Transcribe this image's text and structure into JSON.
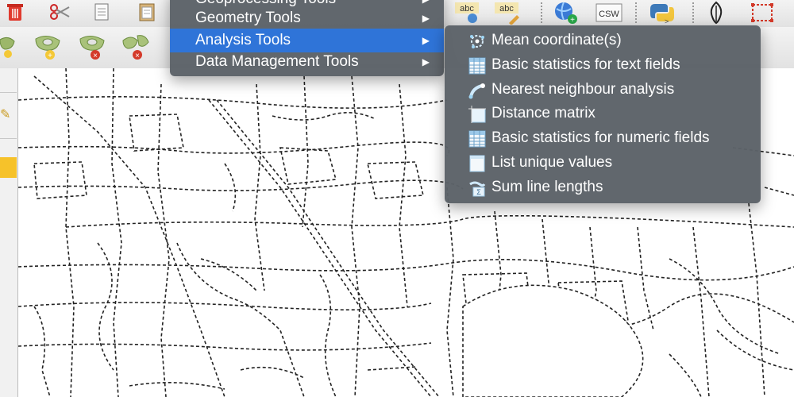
{
  "toolbar": {
    "top_icons": [
      {
        "name": "delete-icon"
      },
      {
        "name": "cut-icon"
      },
      {
        "name": "copy-features-icon"
      },
      {
        "name": "paste-features-icon"
      },
      {
        "name": "label-tool-icon",
        "text": "abc"
      },
      {
        "name": "label-edit-icon",
        "text": "abc"
      },
      {
        "name": "metasearch-icon"
      },
      {
        "name": "csw-icon",
        "text": "CSW"
      },
      {
        "name": "python-console-icon"
      },
      {
        "name": "georeferencer-icon"
      },
      {
        "name": "select-rectangle-icon"
      }
    ],
    "digitize_icons": [
      {
        "name": "add-feature-icon"
      },
      {
        "name": "add-ring-icon"
      },
      {
        "name": "delete-ring-icon"
      },
      {
        "name": "delete-part-icon"
      }
    ]
  },
  "main_menu": {
    "items": [
      {
        "label": "Geoprocessing Tools",
        "has_submenu": true
      },
      {
        "label": "Geometry Tools",
        "has_submenu": true
      },
      {
        "label": "Analysis Tools",
        "has_submenu": true,
        "active": true
      },
      {
        "label": "Data Management Tools",
        "has_submenu": true
      }
    ]
  },
  "submenu": {
    "items": [
      {
        "label": "Mean coordinate(s)",
        "icon": "mean-coordinates-icon"
      },
      {
        "label": "Basic statistics for text fields",
        "icon": "statistics-table-icon"
      },
      {
        "label": "Nearest neighbour analysis",
        "icon": "nearest-neighbour-icon"
      },
      {
        "label": "Distance matrix",
        "icon": "distance-matrix-icon"
      },
      {
        "label": "Basic statistics for numeric fields",
        "icon": "statistics-table-icon"
      },
      {
        "label": "List unique values",
        "icon": "list-unique-icon"
      },
      {
        "label": "Sum line lengths",
        "icon": "sum-lines-icon"
      }
    ]
  },
  "colors": {
    "menu_bg": "#5c6268",
    "highlight": "#2f74d8",
    "map_line": "#222222",
    "panel_highlight": "#f6c22a"
  }
}
